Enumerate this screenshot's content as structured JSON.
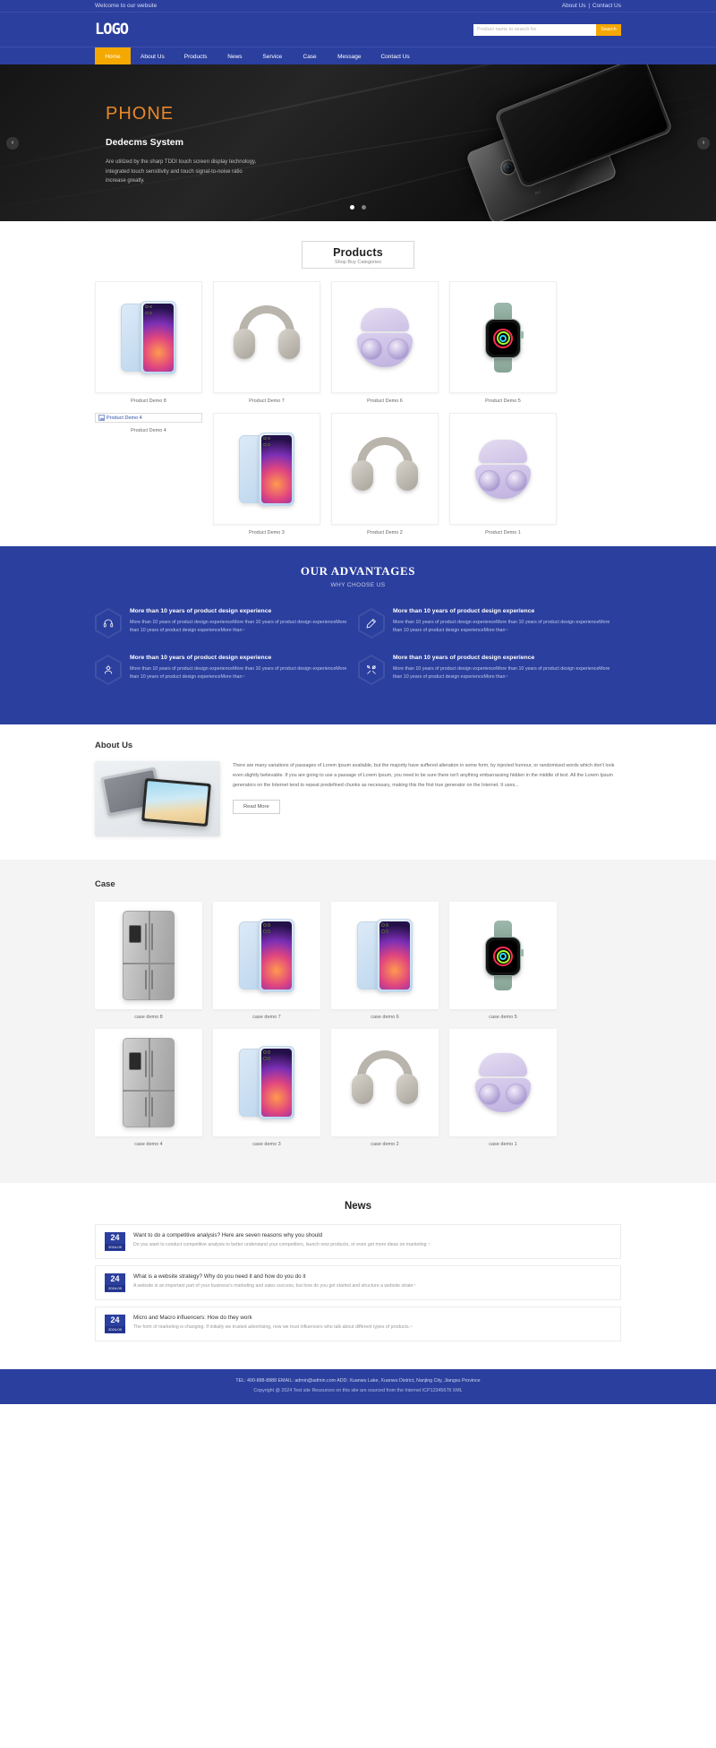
{
  "topbar": {
    "welcome": "Welcome to our website",
    "about": "About Us",
    "divider": "|",
    "contact": "Contact Us"
  },
  "header": {
    "logo": "LOGO",
    "search_placeholder": "Product name to search for",
    "search_value": "",
    "search_button": "Search"
  },
  "nav": {
    "items": [
      {
        "label": "Home",
        "active": true
      },
      {
        "label": "About Us",
        "active": false
      },
      {
        "label": "Products",
        "active": false
      },
      {
        "label": "News",
        "active": false
      },
      {
        "label": "Service",
        "active": false
      },
      {
        "label": "Case",
        "active": false
      },
      {
        "label": "Message",
        "active": false
      },
      {
        "label": "Contact Us",
        "active": false
      }
    ]
  },
  "hero": {
    "title": "PHONE",
    "subtitle": "Dedecms System",
    "description": "Are utilized by the sharp TDDI touch screen display technology, integrated touch sensitivity and touch signal-to-noise ratio increase greatly.",
    "prev_arrow": "‹",
    "next_arrow": "›",
    "brand_mark": "mi",
    "dots": [
      true,
      false
    ]
  },
  "products": {
    "title": "Products",
    "subtitle": "Shop Buy Categories",
    "items": [
      {
        "label": "Product Demo 8",
        "art": "phone",
        "broken": false
      },
      {
        "label": "Product Demo 7",
        "art": "headphones",
        "broken": false
      },
      {
        "label": "Product Demo 6",
        "art": "buds",
        "broken": false
      },
      {
        "label": "Product Demo 5",
        "art": "watch",
        "broken": false
      },
      {
        "label": "Product Demo 4",
        "art": "none",
        "broken": true
      },
      {
        "label": "Product Demo 3",
        "art": "phone",
        "broken": false
      },
      {
        "label": "Product Demo 2",
        "art": "headphones",
        "broken": false
      },
      {
        "label": "Product Demo 1",
        "art": "buds",
        "broken": false
      }
    ]
  },
  "advantages": {
    "title": "OUR ADVANTAGES",
    "subtitle": "WHY CHOOSE US",
    "items": [
      {
        "icon": "headphones-icon",
        "title": "More than 10 years of product design experience",
        "body": "More than 10 years of product design experienceMore than 10 years of product design experienceMore than 10 years of product design experienceMore than~"
      },
      {
        "icon": "pencil-icon",
        "title": "More than 10 years of product design experience",
        "body": "More than 10 years of product design experienceMore than 10 years of product design experienceMore than 10 years of product design experienceMore than~"
      },
      {
        "icon": "gear-person-icon",
        "title": "More than 10 years of product design experience",
        "body": "More than 10 years of product design experienceMore than 10 years of product design experienceMore than 10 years of product design experienceMore than~"
      },
      {
        "icon": "tools-icon",
        "title": "More than 10 years of product design experience",
        "body": "More than 10 years of product design experienceMore than 10 years of product design experienceMore than 10 years of product design experienceMore than~"
      }
    ]
  },
  "about": {
    "title": "About Us",
    "paragraph": "There are many variations of passages of Lorem Ipsum available, but the majority have suffered alteration in some form, by injected humour, or randomised words which don't look even slightly believable. If you are going to use a passage of Lorem Ipsum, you need to be sure there isn't anything embarrassing hidden in the middle of text. All the Lorem Ipsum generators on the Internet tend to repeat predefined chunks as necessary, making this the first true generator on the Internet. It uses...",
    "read_more": "Read More"
  },
  "case": {
    "title": "Case",
    "items": [
      {
        "label": "case demo 8",
        "art": "fridge"
      },
      {
        "label": "case demo 7",
        "art": "phone"
      },
      {
        "label": "case demo 6",
        "art": "phone"
      },
      {
        "label": "case demo 5",
        "art": "watch"
      },
      {
        "label": "case demo 4",
        "art": "fridge"
      },
      {
        "label": "case demo 3",
        "art": "phone"
      },
      {
        "label": "case demo 2",
        "art": "headphones"
      },
      {
        "label": "case demo 1",
        "art": "buds"
      }
    ]
  },
  "news": {
    "title": "News",
    "items": [
      {
        "day": "24",
        "month": "2024-09",
        "title": "Want to do a competitive analysis? Here are seven reasons why you should",
        "excerpt": "Do you want to conduct competitive analysis to better understand your competitors, launch new products, or even get more ideas on marketing ~"
      },
      {
        "day": "24",
        "month": "2024-09",
        "title": "What is a website strategy? Why do you need it and how do you do it",
        "excerpt": "A website is an important part of your business's marketing and sales success, but how do you get started and structure a website strate~"
      },
      {
        "day": "24",
        "month": "2024-09",
        "title": "Micro and Macro influencers: How do they work",
        "excerpt": "The form of marketing is changing. If initially we trusted advertising, now we trust influencers who talk about different types of products.~"
      }
    ]
  },
  "footer": {
    "line1": "TEL: 400-888-8888   EMAIL: admin@admin.com  ADD: Xuanwu Lake, Xuanwu District, Nanjing City, Jiangsu Province",
    "line2": "Copyright @ 2024 Test site Resources on this site are sourced from the Internet   ICP12345678   XML"
  }
}
